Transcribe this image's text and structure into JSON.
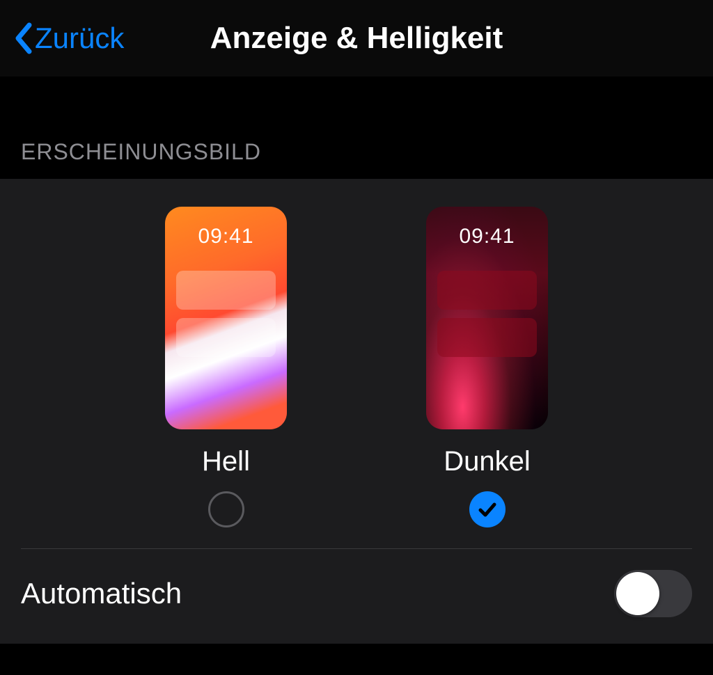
{
  "nav": {
    "back_label": "Zurück",
    "title": "Anzeige & Helligkeit"
  },
  "appearance": {
    "section_header": "ERSCHEINUNGSBILD",
    "preview_time": "09:41",
    "options": {
      "light": {
        "label": "Hell",
        "selected": false
      },
      "dark": {
        "label": "Dunkel",
        "selected": true
      }
    }
  },
  "automatic": {
    "label": "Automatisch",
    "value": false
  },
  "colors": {
    "accent": "#0a84ff"
  }
}
